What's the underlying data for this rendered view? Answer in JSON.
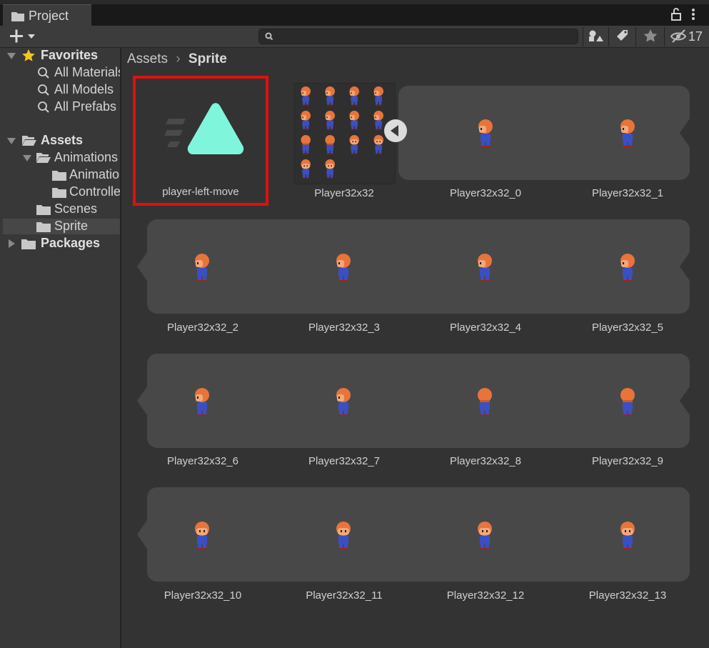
{
  "window": {
    "tab_label": "Project",
    "hidden_count": "17"
  },
  "search": {
    "placeholder": ""
  },
  "sidebar": {
    "favorites": {
      "label": "Favorites",
      "items": [
        "All Materials",
        "All Models",
        "All Prefabs"
      ]
    },
    "assets": {
      "label": "Assets",
      "children": [
        {
          "label": "Animations",
          "children": [
            "Animations",
            "Controllers"
          ]
        },
        {
          "label": "Scenes"
        },
        {
          "label": "Sprite",
          "selected": true
        }
      ]
    },
    "packages": {
      "label": "Packages"
    }
  },
  "breadcrumb": [
    "Assets",
    "Sprite"
  ],
  "assets": [
    {
      "name": "player-left-move",
      "kind": "animation",
      "selected": true
    },
    {
      "name": "Player32x32",
      "kind": "sprite-sheet"
    },
    {
      "name": "Player32x32_0"
    },
    {
      "name": "Player32x32_1"
    },
    {
      "name": "Player32x32_2"
    },
    {
      "name": "Player32x32_3"
    },
    {
      "name": "Player32x32_4"
    },
    {
      "name": "Player32x32_5"
    },
    {
      "name": "Player32x32_6"
    },
    {
      "name": "Player32x32_7"
    },
    {
      "name": "Player32x32_8"
    },
    {
      "name": "Player32x32_9"
    },
    {
      "name": "Player32x32_10"
    },
    {
      "name": "Player32x32_11"
    },
    {
      "name": "Player32x32_12"
    },
    {
      "name": "Player32x32_13"
    }
  ],
  "colors": {
    "selection_border": "#e01010",
    "anim_icon": "#7ff5dc",
    "favorite_star": "#f5c518"
  }
}
